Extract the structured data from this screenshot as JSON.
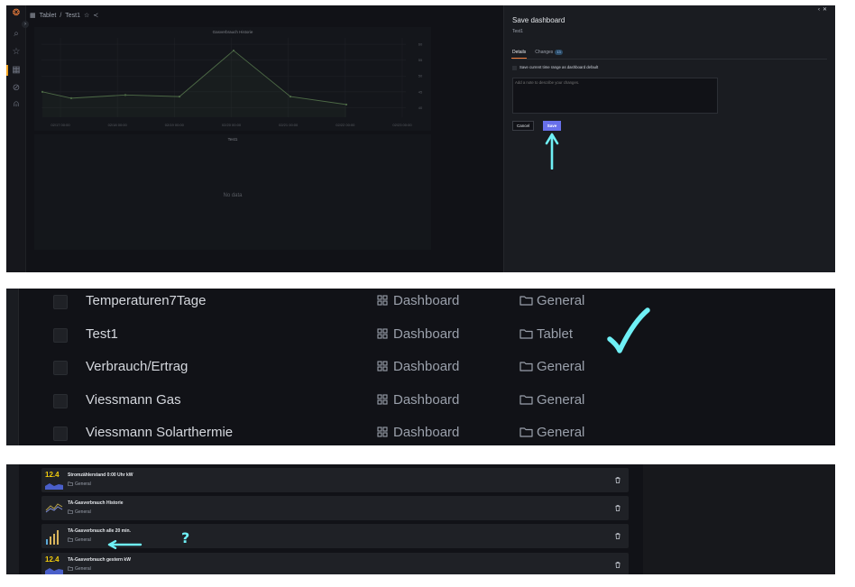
{
  "grafana": {
    "breadcrumb": {
      "folder": "Tablet",
      "separator": "/",
      "dashboard": "Test1"
    },
    "chart_panel": {
      "title": "Gasverbrauch Historie",
      "x_ticks": [
        "02/17 00:00",
        "02/18 00:00",
        "02/19 00:00",
        "02/20 00:00",
        "02/21 00:00",
        "02/22 00:00",
        "02/23 00:00"
      ],
      "y_ticks": [
        "60",
        "55",
        "50",
        "45",
        "40"
      ]
    },
    "empty_panel": {
      "title": "Test1",
      "message": "No data"
    },
    "drawer": {
      "title": "Save dashboard",
      "subtitle": "Test1",
      "tabs": [
        {
          "label": "Details"
        },
        {
          "label": "Changes",
          "badge": "13"
        }
      ],
      "checkbox_label": "Save current time range as dashboard default",
      "note_placeholder": "Add a note to describe your changes.",
      "cancel_label": "Cancel",
      "save_label": "Save"
    }
  },
  "chart_data": {
    "type": "line",
    "title": "Gasverbrauch Historie",
    "x": [
      "02/16 12:00",
      "02/17 00:00",
      "02/18 00:00",
      "02/19 00:00",
      "02/20 00:00",
      "02/21 00:00",
      "02/22 00:00"
    ],
    "series": [
      {
        "values": [
          45,
          43,
          44,
          43.5,
          58,
          43.5,
          41
        ]
      }
    ],
    "ylim": [
      37,
      62
    ],
    "grid": true
  },
  "dashboard_list": {
    "type_label": "Dashboard",
    "rows": [
      {
        "name": "Temperaturen7Tage",
        "folder": "General"
      },
      {
        "name": "Test1",
        "folder": "Tablet"
      },
      {
        "name": "Verbrauch/Ertrag",
        "folder": "General"
      },
      {
        "name": "Viessmann Gas",
        "folder": "General"
      },
      {
        "name": "Viessmann Solarthermie",
        "folder": "General"
      }
    ]
  },
  "library_panels": {
    "items": [
      {
        "title": "Stromzählerstand 0:00 Uhr kW",
        "folder": "General",
        "thumb": "stat",
        "value": "12.4"
      },
      {
        "title": "TA-Gasverbrauch Historie",
        "folder": "General",
        "thumb": "timeseries"
      },
      {
        "title": "TA-Gasverbrauch alle 20 min.",
        "folder": "General",
        "thumb": "bars"
      },
      {
        "title": "TA-Gasverbrauch gestern kW",
        "folder": "General",
        "thumb": "stat",
        "value": "12.4"
      }
    ],
    "annotation_mark": "?"
  },
  "colors": {
    "accent": "#6870ea",
    "annotation": "#6ff0f6",
    "tab_underline": "#f5813d",
    "stat_value": "#f2cc0c"
  }
}
